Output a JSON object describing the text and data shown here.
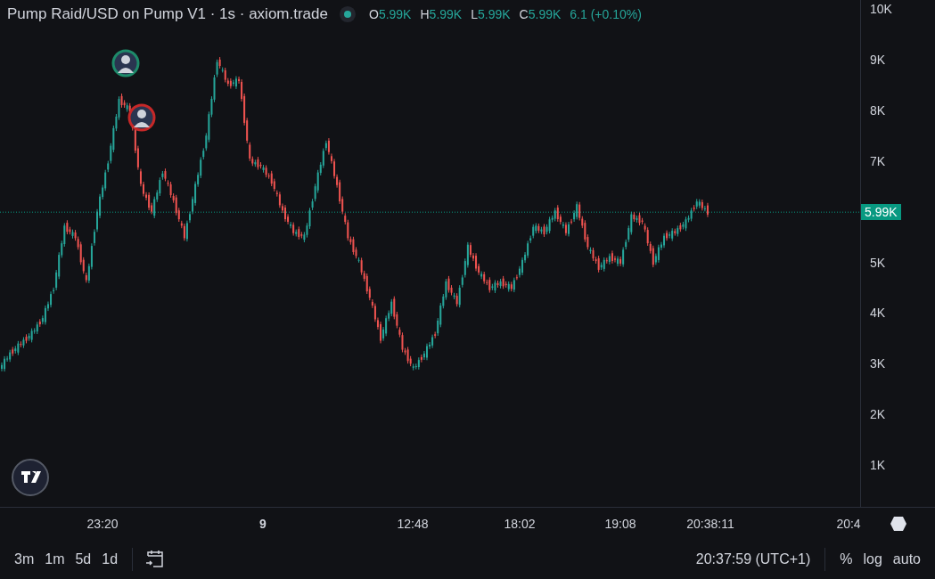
{
  "legend": {
    "title": "Pump Raid/USD on Pump V1 · 1s · axiom.trade",
    "status_on": true,
    "ohlc": [
      {
        "key": "O",
        "value": "5.99K"
      },
      {
        "key": "H",
        "value": "5.99K"
      },
      {
        "key": "L",
        "value": "5.99K"
      },
      {
        "key": "C",
        "value": "5.99K"
      }
    ],
    "change": "6.1 (+0.10%)"
  },
  "chart": {
    "price_axis": [
      "10K",
      "9K",
      "8K",
      "7K",
      "5K",
      "4K",
      "3K",
      "2K",
      "1K"
    ],
    "time_axis": [
      {
        "label": "23:20",
        "bold": false
      },
      {
        "label": "9",
        "bold": true
      },
      {
        "label": "12:48",
        "bold": false
      },
      {
        "label": "18:02",
        "bold": false
      },
      {
        "label": "19:08",
        "bold": false
      },
      {
        "label": "20:38:11",
        "bold": false
      },
      {
        "label": "20:4",
        "bold": false
      }
    ],
    "markers": [
      {
        "color": "#1e8a6a"
      },
      {
        "color": "#c62828"
      }
    ],
    "last_price": "5.99K"
  },
  "toolbar": {
    "ranges": [
      "3m",
      "1m",
      "5d",
      "1d"
    ],
    "time": "20:37:59 (UTC+1)",
    "options": [
      "%",
      "log",
      "auto"
    ]
  }
}
